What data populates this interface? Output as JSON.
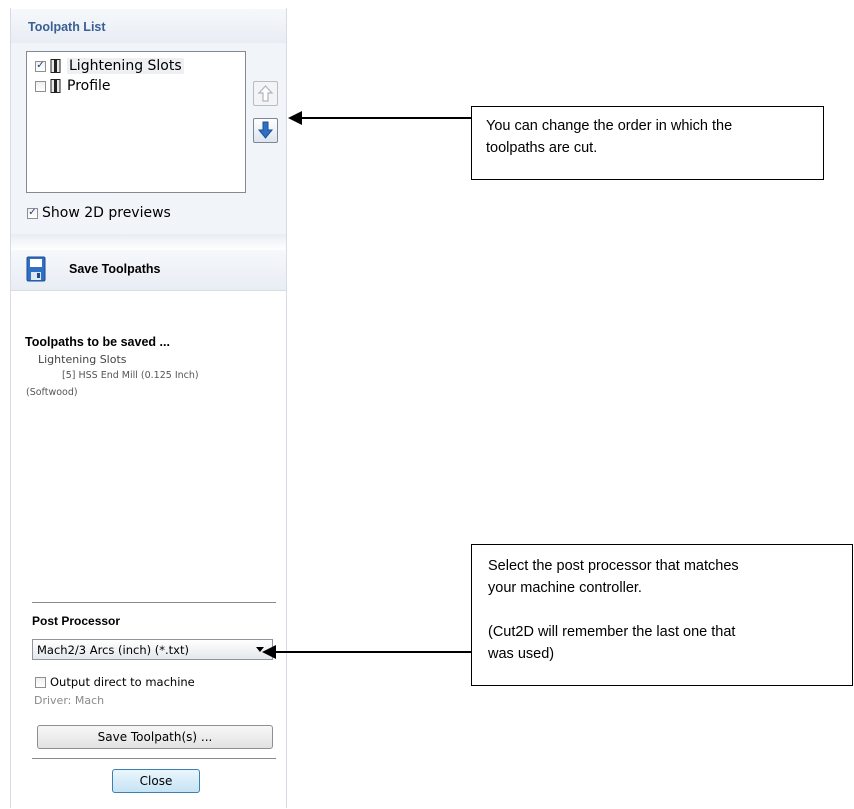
{
  "toolpath_list": {
    "title": "Toolpath List",
    "items": [
      {
        "label": "Lightening Slots",
        "checked": true
      },
      {
        "label": "Profile",
        "checked": false
      }
    ],
    "move_up_icon": "arrow-up-icon",
    "move_down_icon": "arrow-down-icon",
    "show_previews_label": "Show 2D previews",
    "show_previews_checked": true
  },
  "save_toolpaths": {
    "title": "Save Toolpaths",
    "icon": "floppy-disk-icon",
    "to_be_saved_title": "Toolpaths to be saved ...",
    "saved_item_name": "Lightening Slots",
    "saved_item_tool": "[5] HSS End Mill (0.125 Inch)",
    "saved_item_material": "(Softwood)"
  },
  "post_processor": {
    "title": "Post Processor",
    "selected": "Mach2/3 Arcs (inch) (*.txt)",
    "output_direct_label": "Output direct to machine",
    "output_direct_checked": false,
    "driver": "Driver: Mach",
    "save_button": "Save Toolpath(s) ...",
    "close_button": "Close"
  },
  "callouts": {
    "order": [
      "You can change the order in which the",
      "toolpaths are cut."
    ],
    "post": [
      "Select the post processor that matches",
      "your machine controller.",
      "",
      "(Cut2D will remember the last one that",
      "was used)"
    ]
  },
  "colors": {
    "accent": "#3a5f95",
    "arrow_blue": "#2f6fc4"
  }
}
